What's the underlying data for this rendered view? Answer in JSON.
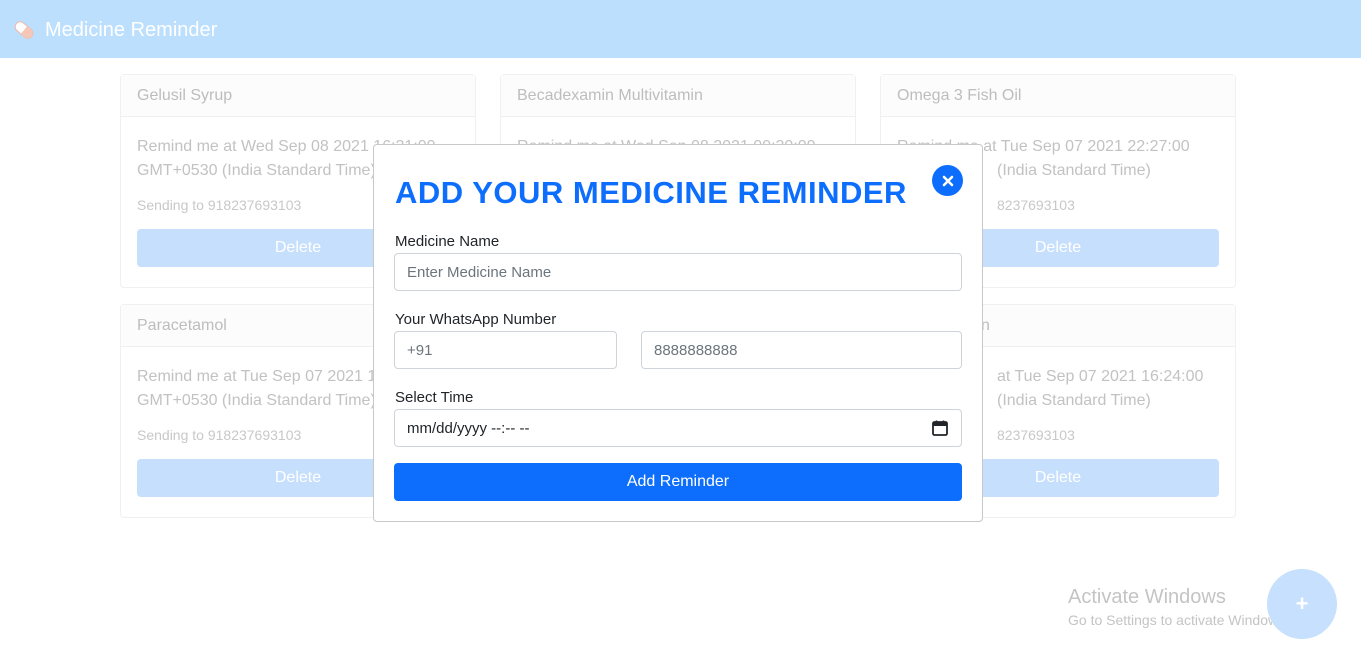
{
  "navbar": {
    "brand": "Medicine Reminder",
    "brand_icon": "pill-icon"
  },
  "cards": [
    {
      "title": "Gelusil Syrup",
      "remind_text": "Remind me at Wed Sep 08 2021 16:31:00 GMT+0530 (India Standard Time)",
      "sending_to": "Sending to 918237693103",
      "delete_label": "Delete"
    },
    {
      "title": "Becadexamin Multivitamin",
      "remind_text": "Remind me at Wed Sep 08 2021 09:30:00",
      "sending_to": "",
      "delete_label": ""
    },
    {
      "title": "Omega 3 Fish Oil",
      "remind_text": "Remind me at Tue Sep 07 2021 22:27:00",
      "remind_text_2": "(India Standard Time)",
      "sending_to": "8237693103",
      "delete_label": "Delete"
    },
    {
      "title": "Paracetamol",
      "remind_text": "Remind me at Tue Sep 07 2021 16",
      "remind_text_2": "GMT+0530 (India Standard Time)",
      "sending_to": "Sending to 918237693103",
      "delete_label": "Delete"
    },
    {
      "title": "",
      "remind_text": "",
      "sending_to": "",
      "delete_label": ""
    },
    {
      "title": "n",
      "remind_text": "at Tue Sep 07 2021 16:24:00",
      "remind_text_2": "(India Standard Time)",
      "sending_to": "8237693103",
      "delete_label": "Delete"
    }
  ],
  "modal": {
    "title": "ADD YOUR MEDICINE REMINDER",
    "close_icon": "close-icon",
    "medicine_label": "Medicine Name",
    "medicine_placeholder": "Enter Medicine Name",
    "whatsapp_label": "Your WhatsApp Number",
    "country_code": "+91",
    "phone_placeholder": "8888888888",
    "time_label": "Select Time",
    "time_placeholder": "mm/dd/yyyy --:-- --",
    "submit_label": "Add Reminder"
  },
  "watermark": {
    "line1": "Activate Windows",
    "line2": "Go to Settings to activate Windows."
  },
  "fab": {
    "label": "+",
    "icon": "plus-icon"
  },
  "colors": {
    "navbar": "#bcdffd",
    "primary": "#0d6efd",
    "card_button": "#c6dffd"
  }
}
